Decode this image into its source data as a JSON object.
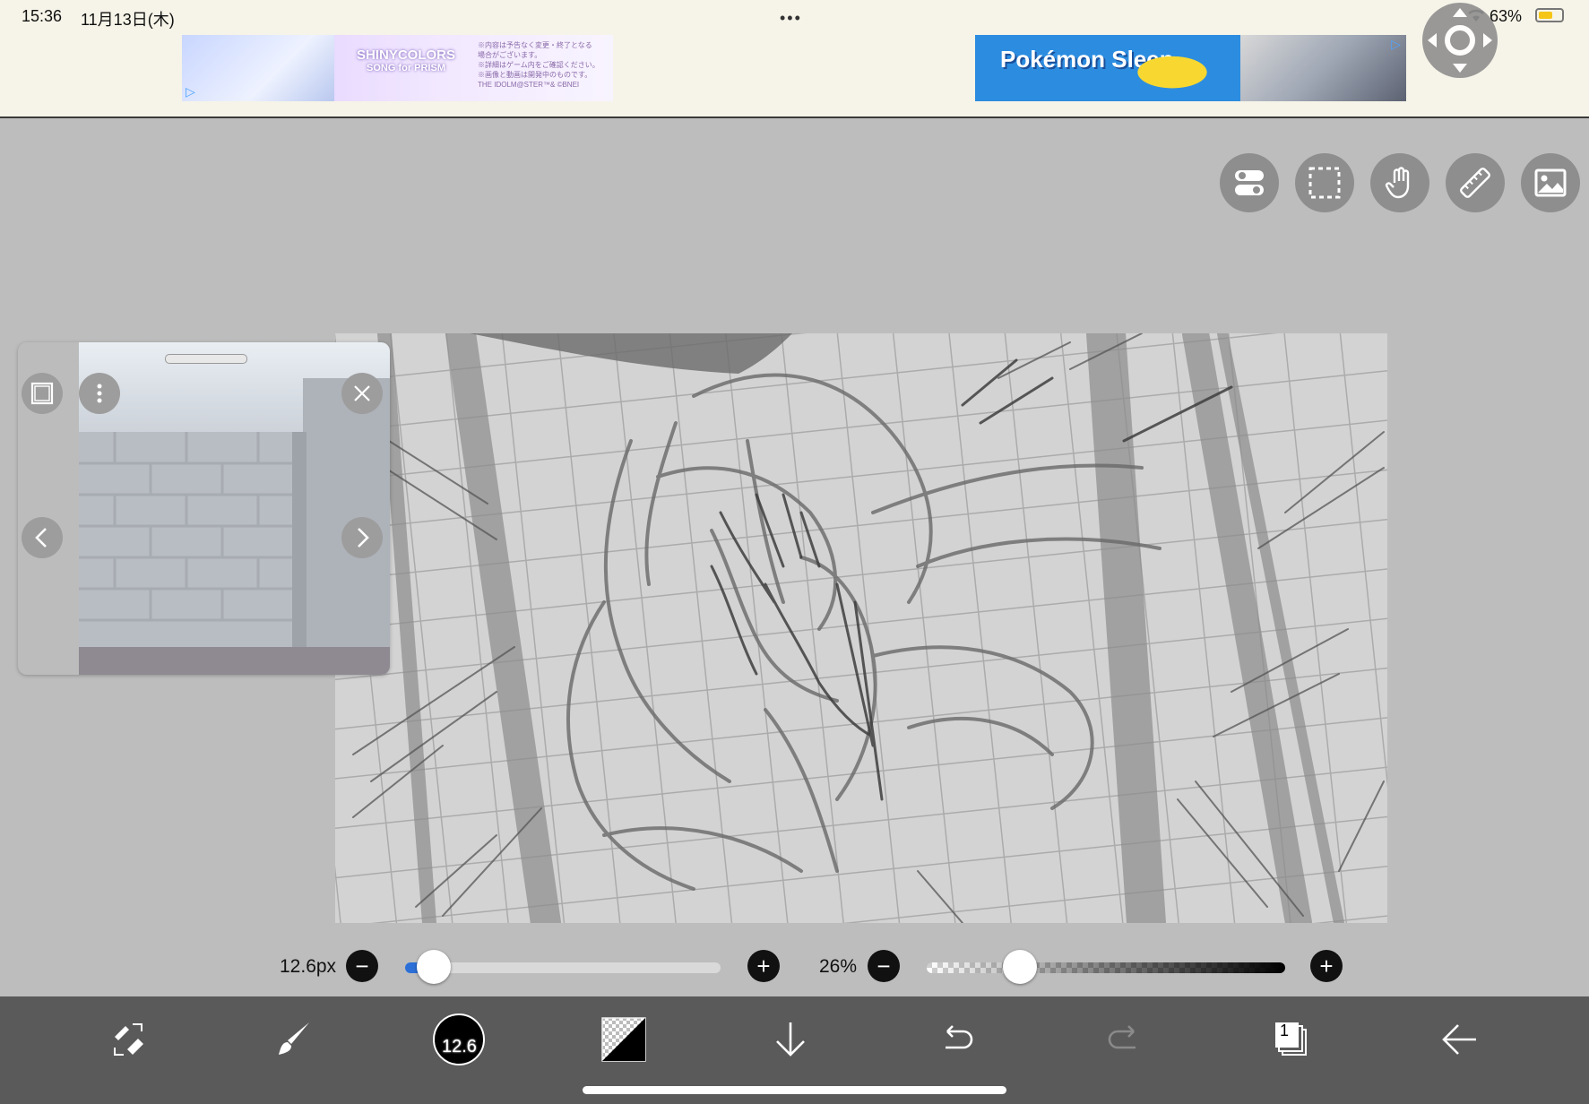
{
  "status_bar": {
    "time": "15:36",
    "date": "11月13日(木)",
    "dots": "•••",
    "battery": "63%",
    "battery_level": 0.63
  },
  "ads": {
    "left": {
      "logo": "SHINYCOLORS",
      "subtitle": "SONG for PRISM",
      "notes": [
        "※内容は予告なく変更・終了となる",
        "場合がございます。",
        "※詳細はゲーム内をご確認ください。",
        "※画像と動画は開発中のものです。",
        "THE IDOLM@STER™& ©BNEI"
      ]
    },
    "right": {
      "logo": "Pokémon Sleep"
    }
  },
  "tools_right": [
    {
      "name": "toggle-settings-icon"
    },
    {
      "name": "selection-icon"
    },
    {
      "name": "hand-tool-icon"
    },
    {
      "name": "ruler-icon"
    },
    {
      "name": "image-import-icon"
    }
  ],
  "brush": {
    "size_label": "12.6px",
    "size_value": 12.6,
    "size_fraction": 0.09,
    "opacity_label": "26%",
    "opacity_fraction": 0.26,
    "minus": "−",
    "plus": "+"
  },
  "toolbar": {
    "brush_size_badge": "12.6",
    "layer_count": "1",
    "colors": {
      "bar": "#5a5a5a",
      "accent": "#2c6fd6"
    }
  }
}
